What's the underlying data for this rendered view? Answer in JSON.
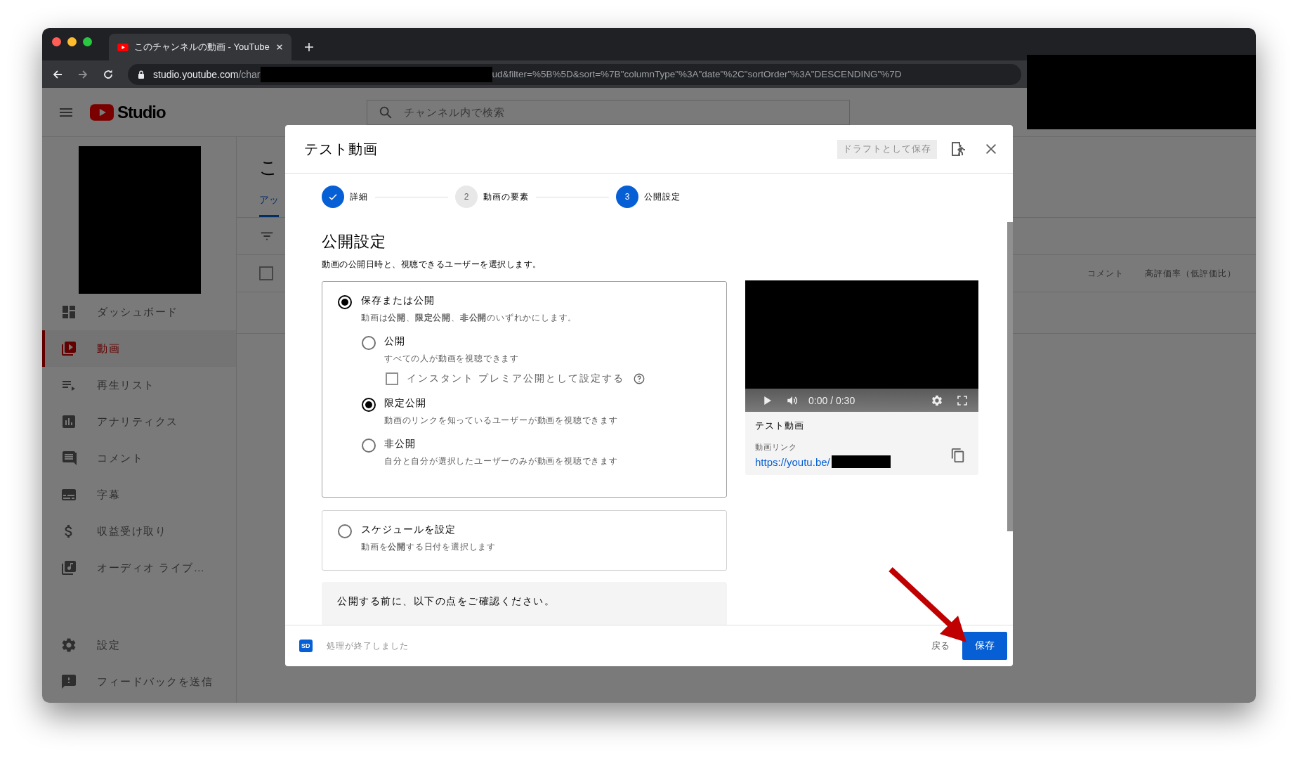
{
  "browser": {
    "tab_title": "このチャンネルの動画 - YouTube",
    "address": {
      "host": "studio.youtube.com",
      "path": "/char",
      "tail": "ud&filter=%5B%5D&sort=%7B\"columnType\"%3A\"date\"%2C\"sortOrder\"%3A\"DESCENDING\"%7D"
    }
  },
  "app": {
    "logo": "Studio",
    "search_placeholder": "チャンネル内で検索"
  },
  "sidebar": {
    "items": [
      {
        "label": "ダッシュボード",
        "selected": false
      },
      {
        "label": "動画",
        "selected": true
      },
      {
        "label": "再生リスト",
        "selected": false
      },
      {
        "label": "アナリティクス",
        "selected": false
      },
      {
        "label": "コメント",
        "selected": false
      },
      {
        "label": "字幕",
        "selected": false
      },
      {
        "label": "収益受け取り",
        "selected": false
      },
      {
        "label": "オーディオ ライブ…",
        "selected": false
      }
    ],
    "bottom_items": [
      {
        "label": "設定"
      },
      {
        "label": "フィードバックを送信"
      }
    ]
  },
  "page": {
    "title": "こ",
    "tab": "アッ",
    "select_all": {
      "checked": false
    },
    "columns": [
      "コメント",
      "高評価率（低評価比）"
    ]
  },
  "dialog": {
    "title": "テスト動画",
    "draft_button": "ドラフトとして保存",
    "steps": [
      {
        "label": "詳細",
        "done": true,
        "selected": false
      },
      {
        "number": "2",
        "label": "動画の要素",
        "done": false,
        "selected": false
      },
      {
        "number": "3",
        "label": "公開設定",
        "done": false,
        "selected": true
      }
    ],
    "heading": "公開設定",
    "subtitle": "動画の公開日時と、視聴できるユーザーを選択します。",
    "visibility": {
      "label": "保存または公開",
      "description": "動画は**公開**、**限定公開**、**非公開**のいずれかにします。",
      "selected": true,
      "options": [
        {
          "label": "公開",
          "description": "すべての人が動画を視聴できます",
          "selected": false
        },
        {
          "label": "限定公開",
          "description": "動画のリンクを知っているユーザーが動画を視聴できます",
          "selected": true
        },
        {
          "label": "非公開",
          "description": "自分と自分が選択したユーザーのみが動画を視聴できます",
          "selected": false
        }
      ],
      "premiere": {
        "label": "インスタント プレミア公開として設定する",
        "checked": false
      }
    },
    "schedule": {
      "label": "スケジュールを設定",
      "description": "動画を**公開**する日付を選択します",
      "selected": false
    },
    "notice": "公開する前に、以下の点をご確認ください。",
    "preview": {
      "time": "0:00 / 0:30",
      "title": "テスト動画",
      "link_label": "動画リンク",
      "link": "https://youtu.be/"
    },
    "footer": {
      "badge": "SD",
      "status": "処理が終了しました",
      "back": "戻る",
      "save": "保存"
    }
  }
}
